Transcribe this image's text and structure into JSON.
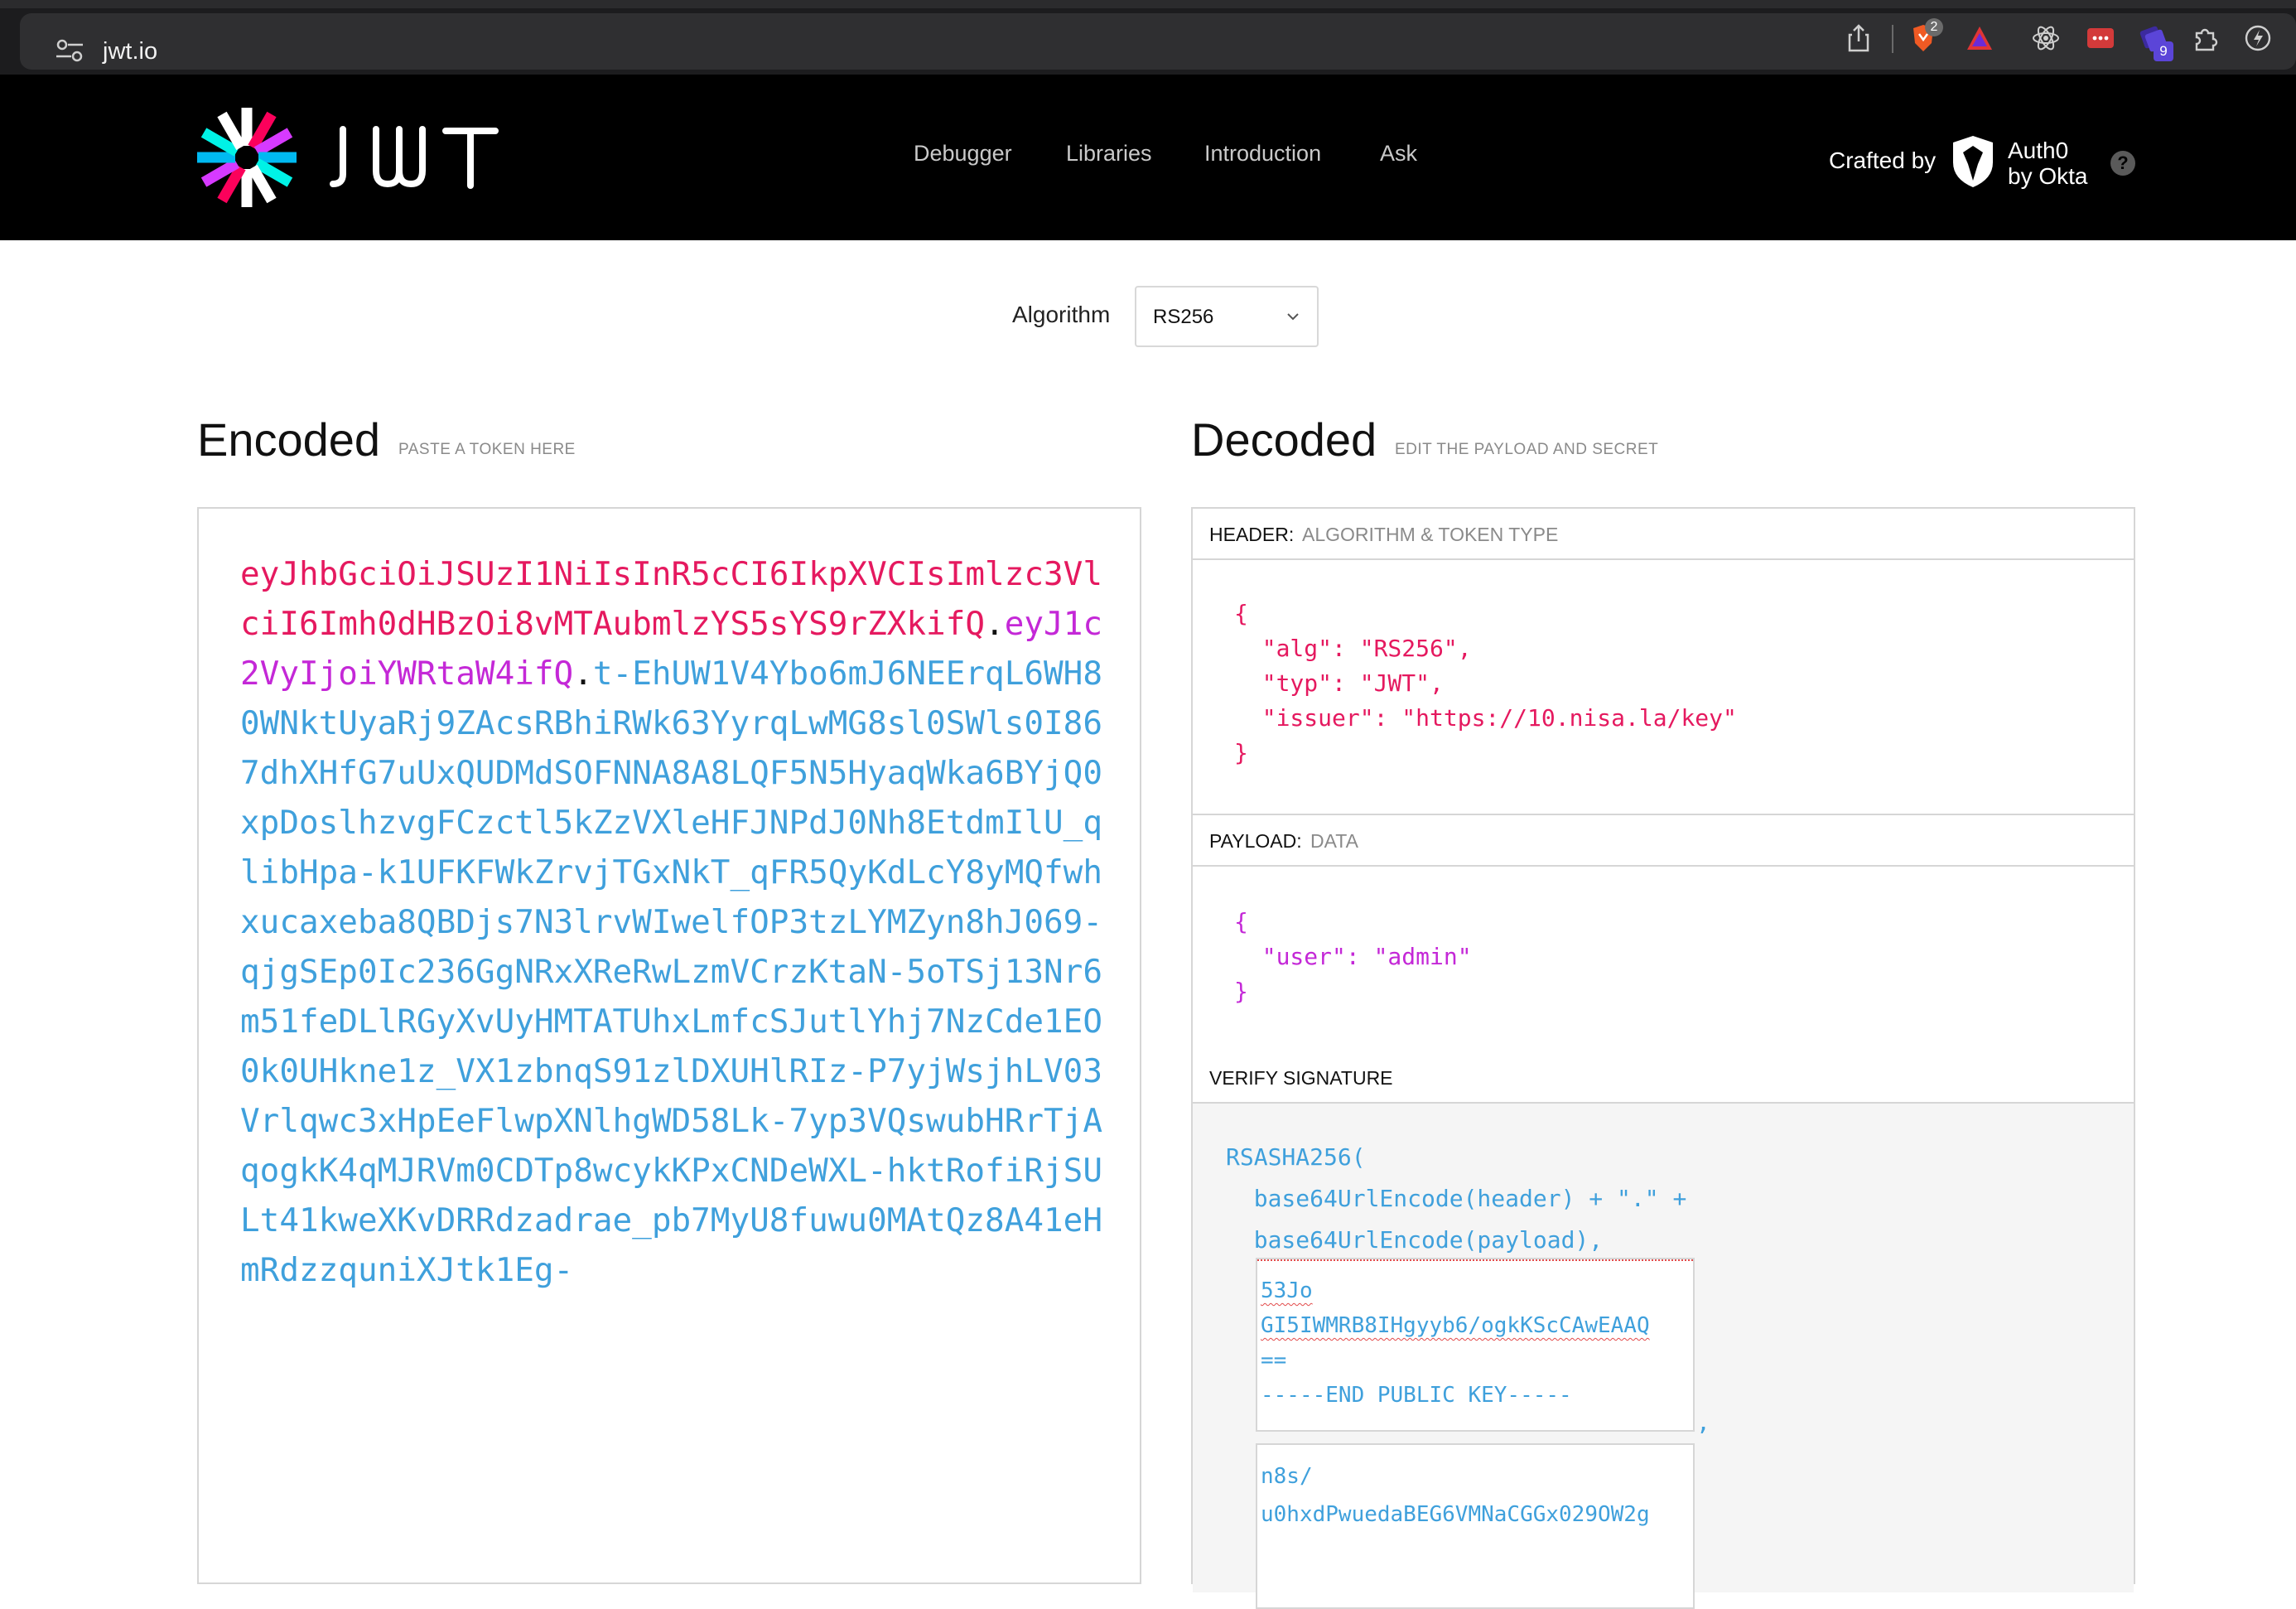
{
  "browser": {
    "url": "jwt.io",
    "badges": {
      "brave_count": "2",
      "extension_count": "9"
    }
  },
  "site": {
    "nav": [
      "Debugger",
      "Libraries",
      "Introduction",
      "Ask"
    ],
    "crafted_by": "Crafted by",
    "brand_line1": "Auth0",
    "brand_line2": "by Okta",
    "help": "?"
  },
  "algorithm": {
    "label": "Algorithm",
    "selected": "RS256"
  },
  "encoded": {
    "title": "Encoded",
    "hint": "PASTE A TOKEN HERE",
    "token_header": "eyJhbGciOiJSUzI1NiIsInR5cCI6IkpXVCIsImlzc3VlciI6Imh0dHBzOi8vMTAubmlzYS5sYS9rZXkifQ",
    "token_payload": "eyJ1c2VyIjoiYWRtaW4ifQ",
    "token_signature": "t-EhUW1V4Ybo6mJ6NEErqL6WH80WNktUyaRj9ZAcsRBhiRWk63YyrqLwMG8sl0SWls0I867dhXHfG7uUxQUDMdSOFNNA8A8LQF5N5HyaqWka6BYjQ0xpDoslhzvgFCzctl5kZzVXleHFJNPdJ0Nh8EtdmIlU_qlibHpa-k1UFKFWkZrvjTGxNkT_qFR5QyKdLcY8yMQfwhxucaxeba8QBDjs7N3lrvWIwelfOP3tzLYMZyn8hJ069-qjgSEp0Ic236GgNRxXReRwLzmVCrzKtaN-5oTSj13Nr6m51feDLlRGyXvUyHMTATUhxLmfcSJutlYhj7NzCde1EO0k0UHkne1z_VX1zbnqS91zlDXUHlRIz-P7yjWsjhLV03Vrlqwc3xHpEeFlwpXNlhgWD58Lk-7yp3VQswubHRrTjAqogkK4qMJRVm0CDTp8wcykKPxCNDeWXL-hktRofiRjSULt41kweXKvDRRdzadrae_pb7MyU8fuwu0MAtQz8A41eHmRdzzquniXJtk1Eg-",
    "dot": "."
  },
  "decoded": {
    "title": "Decoded",
    "hint": "EDIT THE PAYLOAD AND SECRET",
    "header_label": "HEADER:",
    "header_sub": "ALGORITHM & TOKEN TYPE",
    "header_json": "{\n  \"alg\": \"RS256\",\n  \"typ\": \"JWT\",\n  \"issuer\": \"https://10.nisa.la/key\"\n}",
    "payload_label": "PAYLOAD:",
    "payload_sub": "DATA",
    "payload_json": "{\n  \"user\": \"admin\"\n}",
    "verify_label": "VERIFY SIGNATURE",
    "sig_code": "RSASHA256(\n  base64UrlEncode(header) + \".\" +\n  base64UrlEncode(payload),",
    "public_key_lines": [
      "53Jo",
      "GI5IWMRB8IHgyyb6/ogkKScCAwEAAQ",
      "==",
      "-----END PUBLIC KEY-----"
    ],
    "private_key_lines": [
      "n8s/",
      "u0hxdPwuedaBEG6VMNaCGGx029OW2g"
    ],
    "comma": ","
  },
  "colors": {
    "header_red": "#e5195f",
    "payload_purple": "#c428d7",
    "signature_blue": "#3fa0dc"
  }
}
